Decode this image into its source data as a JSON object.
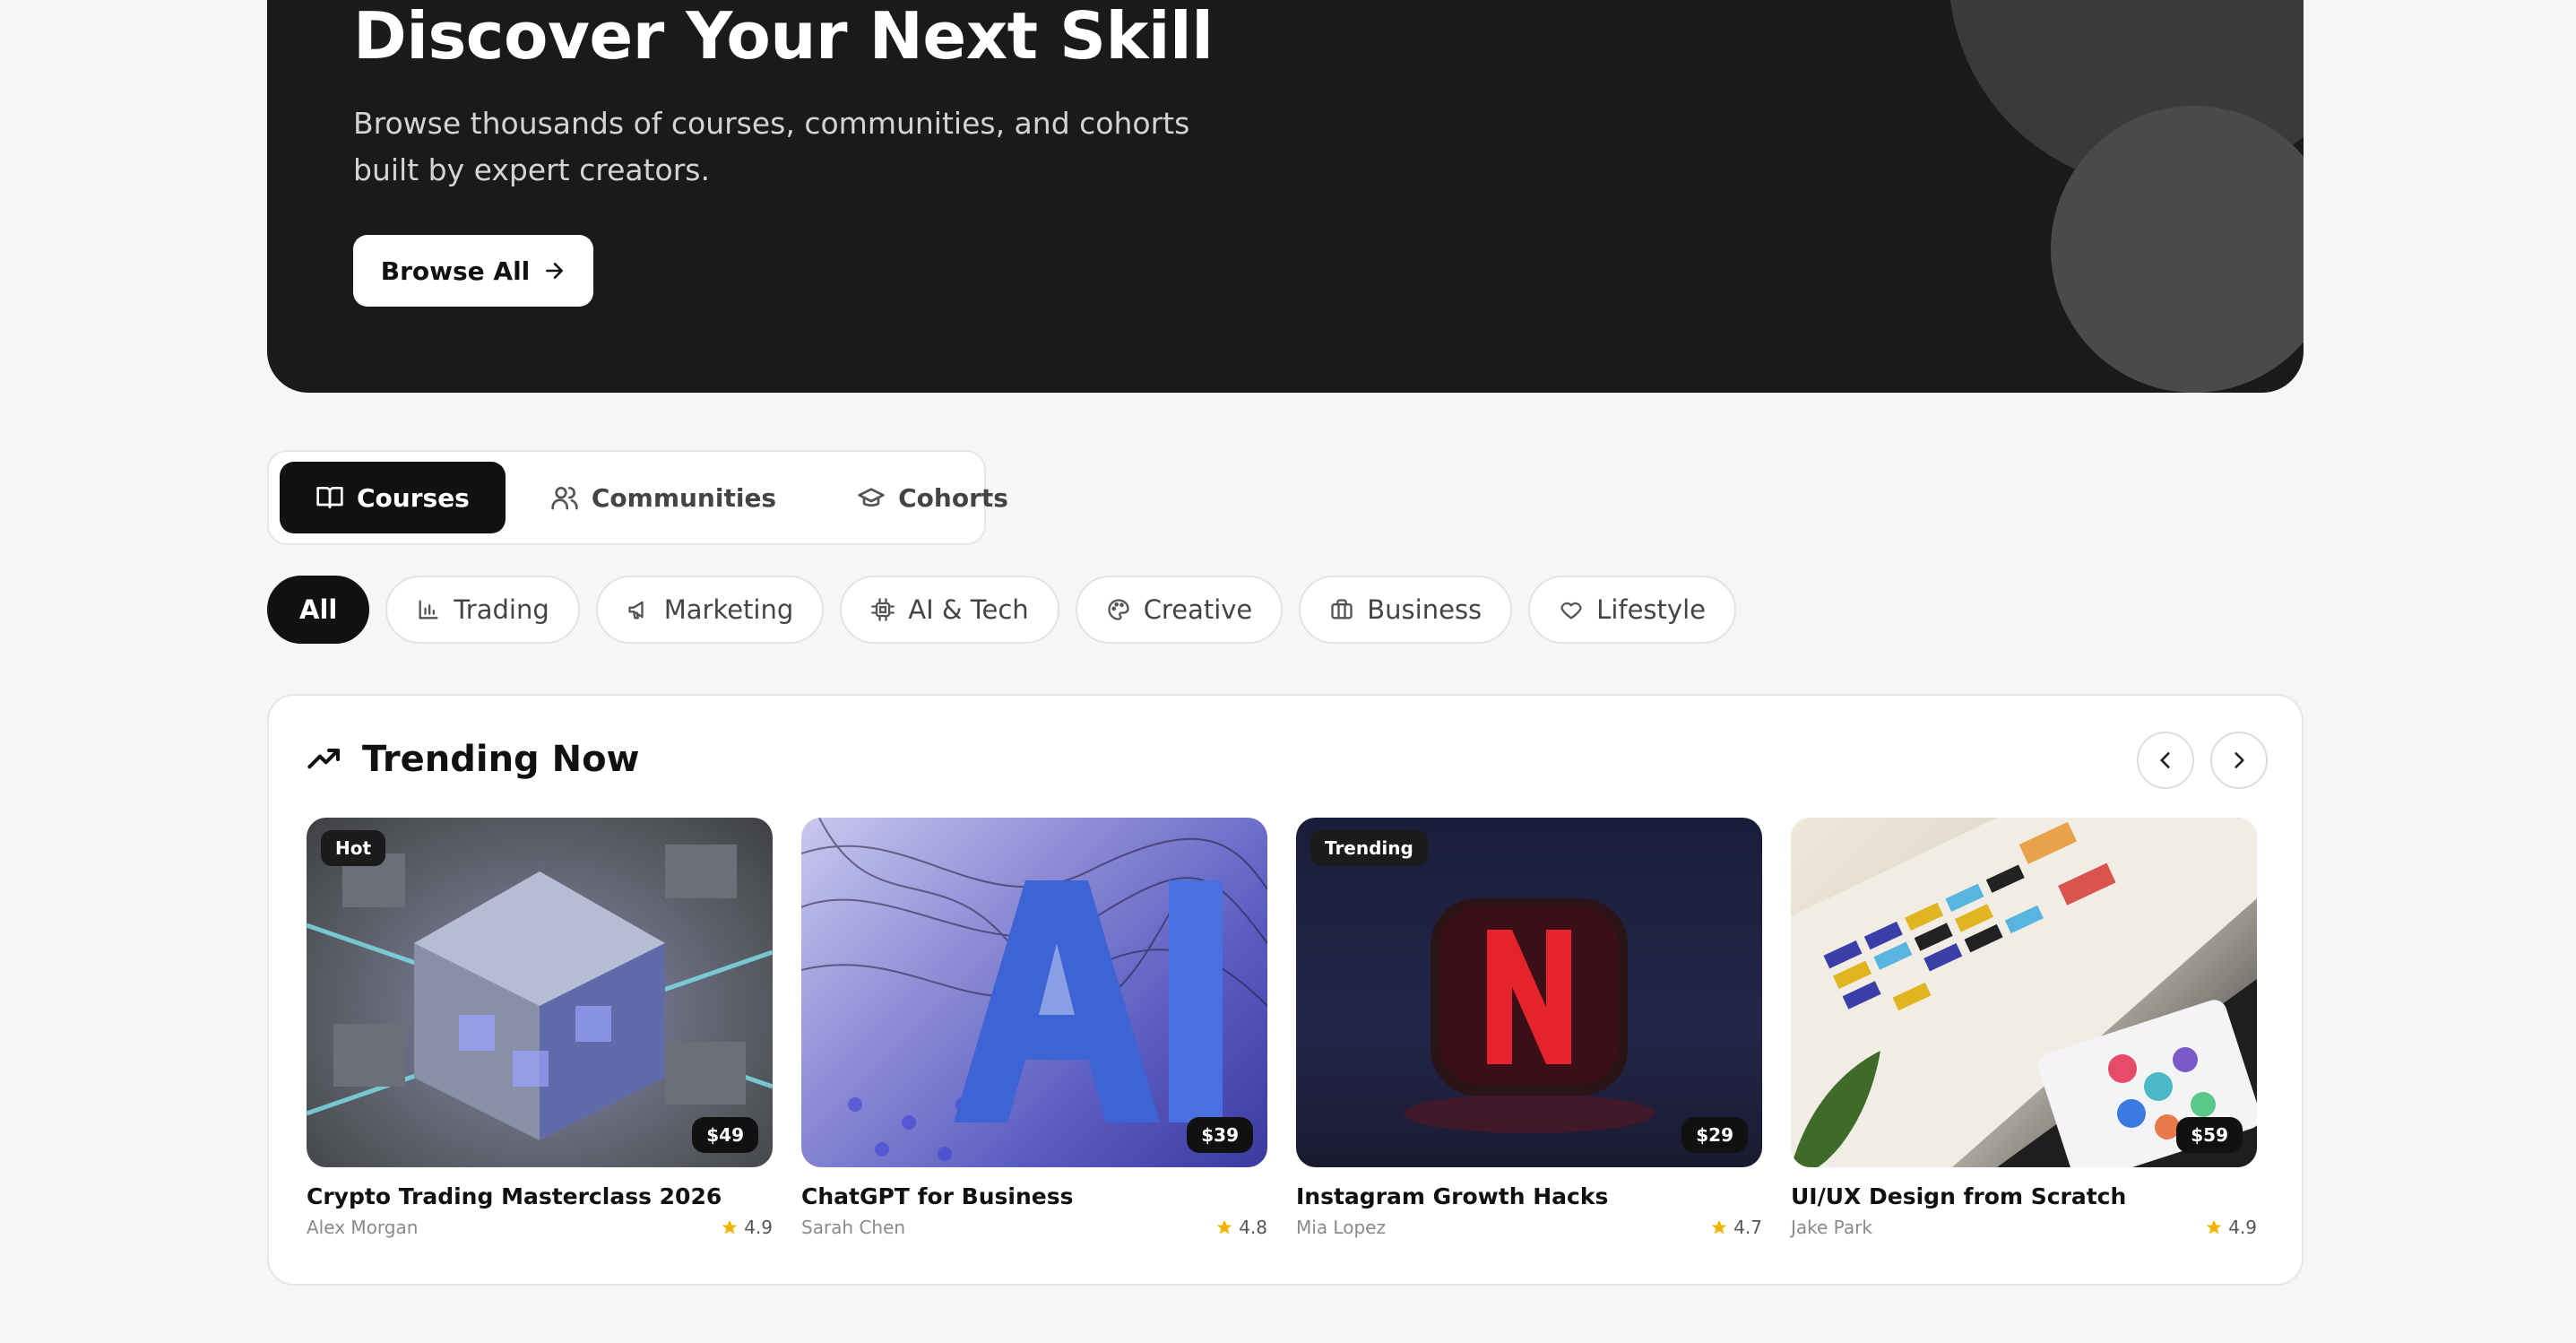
{
  "hero": {
    "title": "Discover Your Next Skill",
    "subtitle": "Browse thousands of courses, communities, and cohorts built by expert creators.",
    "browse_label": "Browse All"
  },
  "type_tabs": [
    {
      "label": "Courses",
      "icon": "book-open-icon",
      "active": true
    },
    {
      "label": "Communities",
      "icon": "users-icon",
      "active": false
    },
    {
      "label": "Cohorts",
      "icon": "graduation-cap-icon",
      "active": false
    }
  ],
  "categories": [
    {
      "label": "All",
      "icon": "",
      "active": true
    },
    {
      "label": "Trading",
      "icon": "bar-chart-icon",
      "active": false
    },
    {
      "label": "Marketing",
      "icon": "megaphone-icon",
      "active": false
    },
    {
      "label": "AI & Tech",
      "icon": "cpu-icon",
      "active": false
    },
    {
      "label": "Creative",
      "icon": "palette-icon",
      "active": false
    },
    {
      "label": "Business",
      "icon": "briefcase-icon",
      "active": false
    },
    {
      "label": "Lifestyle",
      "icon": "heart-icon",
      "active": false
    }
  ],
  "trending": {
    "title": "Trending Now",
    "cards": [
      {
        "title": "Crypto Trading Masterclass 2026",
        "author": "Alex Morgan",
        "rating": "4.9",
        "price": "$49",
        "badge": "Hot"
      },
      {
        "title": "ChatGPT for Business",
        "author": "Sarah Chen",
        "rating": "4.8",
        "price": "$39",
        "badge": ""
      },
      {
        "title": "Instagram Growth Hacks",
        "author": "Mia Lopez",
        "rating": "4.7",
        "price": "$29",
        "badge": "Trending"
      },
      {
        "title": "UI/UX Design from Scratch",
        "author": "Jake Park",
        "rating": "4.9",
        "price": "$59",
        "badge": ""
      }
    ]
  },
  "colors": {
    "accent": "#111111",
    "star": "#f5b400",
    "hero_bg": "#1a1a1a"
  }
}
